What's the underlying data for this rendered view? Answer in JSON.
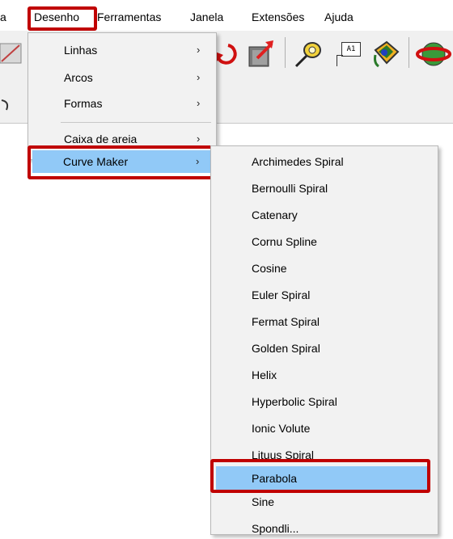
{
  "menubar": {
    "items": [
      {
        "label": "a"
      },
      {
        "label": "Desenho"
      },
      {
        "label": "Ferramentas"
      },
      {
        "label": "Janela"
      },
      {
        "label": "Extensões"
      },
      {
        "label": "Ajuda"
      }
    ],
    "active": "Desenho"
  },
  "toolbar": {
    "icons": [
      "rotate-icon",
      "push-pull-icon",
      "tape-measure-icon",
      "text-icon",
      "paint-bucket-icon",
      "orbit-icon"
    ],
    "text_icon_label": "A1"
  },
  "desenho_menu": {
    "items": [
      {
        "label": "Linhas",
        "submenu": true
      },
      {
        "label": "Arcos",
        "submenu": true
      },
      {
        "label": "Formas",
        "submenu": true
      },
      {
        "label": "Caixa de areia",
        "submenu": true
      },
      {
        "label": "Curve Maker",
        "submenu": true,
        "selected": true
      }
    ],
    "arrow": "›"
  },
  "curve_maker_menu": {
    "items": [
      {
        "label": "Archimedes Spiral"
      },
      {
        "label": "Bernoulli Spiral"
      },
      {
        "label": "Catenary"
      },
      {
        "label": "Cornu Spline"
      },
      {
        "label": "Cosine"
      },
      {
        "label": "Euler Spiral"
      },
      {
        "label": "Fermat Spiral"
      },
      {
        "label": "Golden Spiral"
      },
      {
        "label": "Helix"
      },
      {
        "label": "Hyperbolic Spiral"
      },
      {
        "label": "Ionic Volute"
      },
      {
        "label": "Lituus Spiral"
      },
      {
        "label": "Parabola",
        "selected": true
      },
      {
        "label": "Sine"
      },
      {
        "label": "Spondli..."
      }
    ]
  },
  "colors": {
    "highlight_red": "#c00000",
    "selection_blue": "#91c9f7",
    "menu_bg": "#f2f2f2"
  }
}
